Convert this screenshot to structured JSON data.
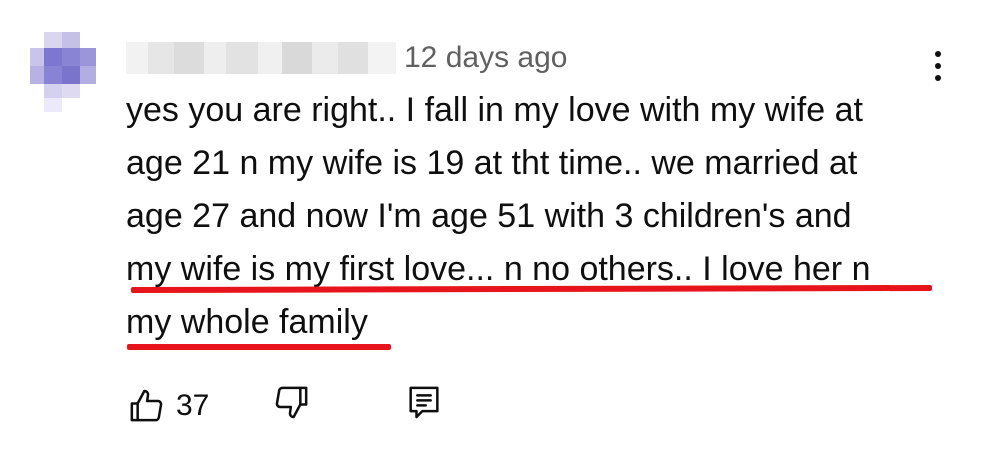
{
  "comment": {
    "timestamp": "12 days ago",
    "lines": [
      "yes you are right.. I fall in my love with my wife at",
      "age 21 n my wife is 19 at tht time.. we married at",
      "age 27 and now I'm age 51 with 3 children's and",
      "my wife is my first love... n no others.. I love her n",
      "my whole family"
    ],
    "like_count": "37",
    "highlight_color": "#e8141b"
  },
  "icons": {
    "avatar": "avatar-pixelated",
    "menu": "more-vert-icon",
    "like": "thumbs-up-icon",
    "dislike": "thumbs-down-icon",
    "reply": "reply-comment-icon"
  }
}
